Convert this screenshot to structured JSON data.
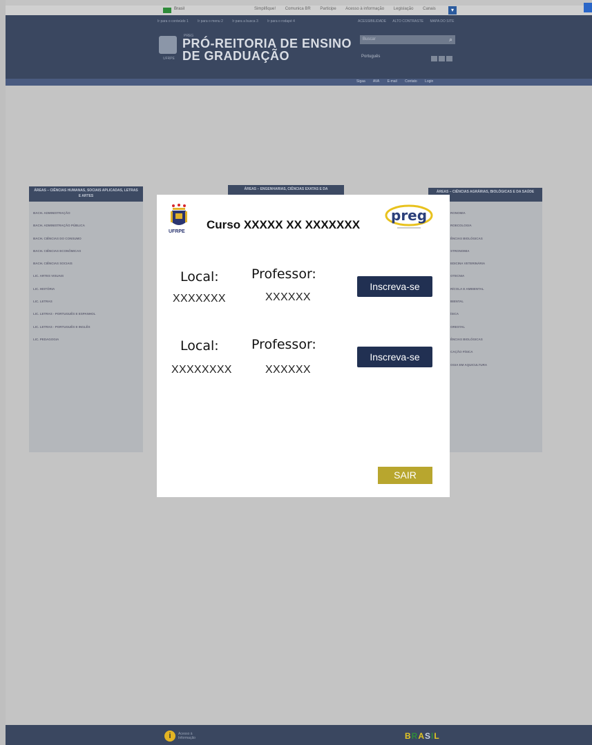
{
  "gov_bar": {
    "label": "Brasil",
    "links": [
      "Simplifique!",
      "Comunica BR",
      "Participe",
      "Acesso à informação",
      "Legislação",
      "Canais"
    ]
  },
  "header": {
    "access_links": [
      "Ir para o conteúdo 1",
      "Ir para o menu 2",
      "Ir para a busca 3",
      "Ir para o rodapé 4"
    ],
    "aux_links": [
      "ACESSIBILIDADE",
      "ALTO CONTRASTE",
      "MAPA DO SITE"
    ],
    "logo_caption": "UFRPE",
    "preg_small": "PREG",
    "title_line1": "PRÓ-REITORIA DE ENSINO",
    "title_line2": "DE GRADUAÇÃO",
    "search_placeholder": "Buscar",
    "language": "Português"
  },
  "nav": {
    "links": [
      "Sigaa",
      "AVA",
      "E-mail",
      "Contato",
      "Login"
    ]
  },
  "panels": {
    "left": {
      "heading": "ÁREAS – CIÊNCIAS HUMANAS, SOCIAIS APLICADAS, LETRAS E ARTES",
      "items": [
        "BACH. ADMINISTRAÇÃO",
        "BACH. ADMINISTRAÇÃO PÚBLICA",
        "BACH. CIÊNCIAS DO CONSUMO",
        "BACH. CIÊNCIAS ECONÔMICAS",
        "BACH. CIÊNCIAS SOCIAIS",
        "LIC. ARTES VISUAIS",
        "LIC. HISTÓRIA",
        "LIC. LETRAS",
        "LIC. LETRAS - PORTUGUÊS E ESPANHOL",
        "LIC. LETRAS - PORTUGUÊS E INGLÊS",
        "LIC. PEDAGOGIA"
      ]
    },
    "middle": {
      "heading": "ÁREAS – ENGENHARIAS, CIÊNCIAS EXATAS E DA"
    },
    "right": {
      "heading": "ÁREAS – CIÊNCIAS AGRÁRIAS, BIOLÓGICAS E DA SAÚDE",
      "items": [
        "RONOMIA",
        "ROECOLOGIA",
        "ÊNCIAS BIOLÓGICAS",
        "STRONOMIA",
        "EDICINA VETERINÁRIA",
        "OTECNIA",
        "RÍCOLA E AMBIENTAL",
        "BIENTAL",
        "ÍSICA",
        "ORESTAL",
        "ÊNCIAS BIOLÓGICAS",
        "CAÇÃO FÍSICA",
        "OGIA EM AQUICULTURA"
      ]
    }
  },
  "modal": {
    "ufrpe_label": "UFRPE",
    "title": "Curso XXXXX XX XXXXXXX",
    "preg_logo": "preg",
    "entries": [
      {
        "local_label": "Local:",
        "local_value": "XXXXXXX",
        "prof_label": "Professor:",
        "prof_value": "XXXXXX",
        "button": "Inscreva-se"
      },
      {
        "local_label": "Local:",
        "local_value": "XXXXXXXX",
        "prof_label": "Professor:",
        "prof_value": "XXXXXX",
        "button": "Inscreva-se"
      }
    ],
    "exit_button": "SAIR"
  },
  "footer": {
    "info_icon_glyph": "i",
    "info_text_line1": "Acesso à",
    "info_text_line2": "Informação",
    "brasil_letters": [
      "B",
      "R",
      "A",
      "S",
      "I",
      "L"
    ]
  },
  "colors": {
    "header_bg": "#3a4760",
    "primary_button": "#213052",
    "exit_button": "#b8a62e",
    "modal_bg": "#ffffff"
  }
}
